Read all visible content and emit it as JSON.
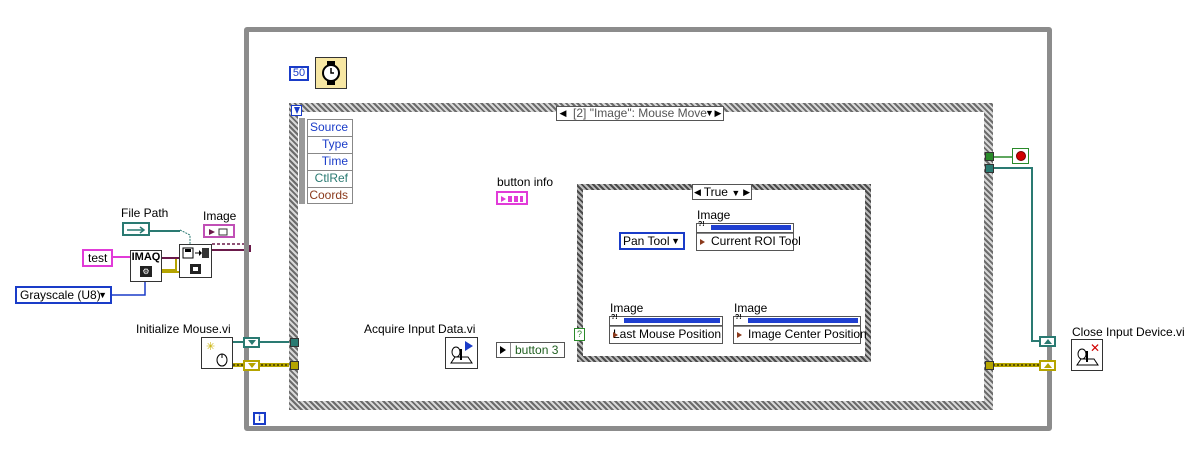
{
  "wait_ms": "50",
  "event": {
    "selector": "[2] \"Image\": Mouse Move",
    "data_fields": [
      "Source",
      "Type",
      "Time",
      "CtlRef",
      "Coords"
    ]
  },
  "case": {
    "selector": "True"
  },
  "labels": {
    "file_path": "File Path",
    "image": "Image",
    "initialize_mouse": "Initialize Mouse.vi",
    "acquire_input": "Acquire Input Data.vi",
    "button_info": "button info",
    "close_input": "Close Input Device.vi"
  },
  "constants": {
    "test": "test",
    "grayscale": "Grayscale (U8)",
    "button3": "button 3",
    "pan_tool": "Pan Tool"
  },
  "imaq_block": "IMAQ",
  "property_nodes": {
    "roi": {
      "label": "Image",
      "item": "Current ROI Tool"
    },
    "mouse": {
      "label": "Image",
      "item": "Last Mouse Position"
    },
    "center": {
      "label": "Image",
      "item": "Image Center Position"
    }
  },
  "colors": {
    "loop_border": "#8c8c8c",
    "wire_blue": "#1a3cc8",
    "wire_teal": "#2a7a72",
    "wire_pink": "#e13bd8",
    "wire_purple": "#6b1a4a",
    "wire_yellow": "#b5a400",
    "stop_red": "#d10000"
  }
}
